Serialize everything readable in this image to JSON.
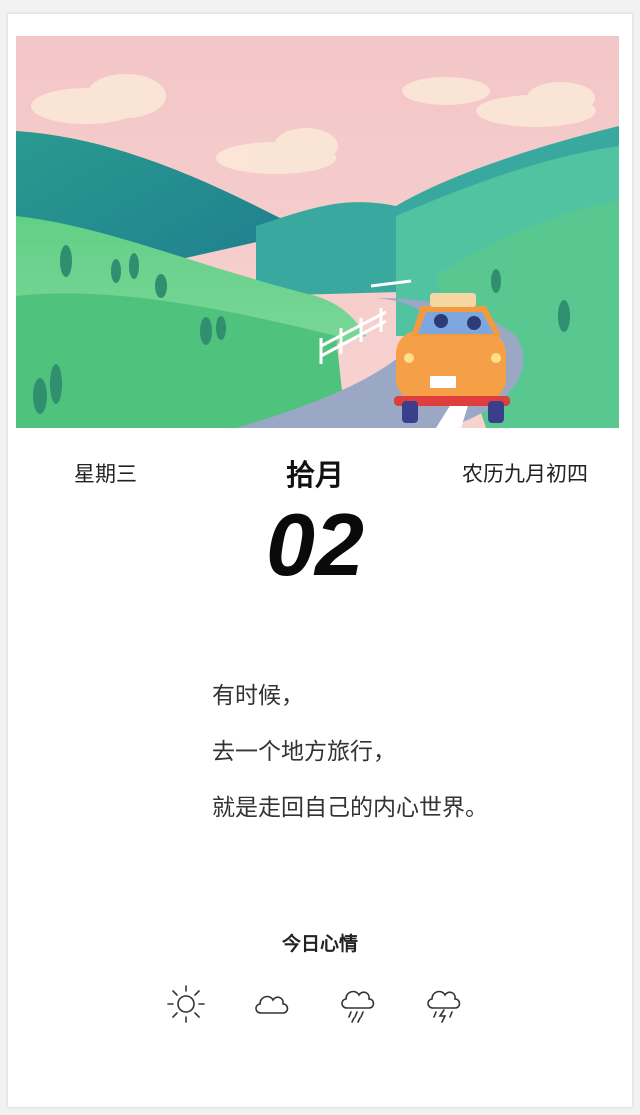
{
  "calendar": {
    "weekday": "星期三",
    "month": "拾月",
    "lunar_date": "农历九月初四",
    "day": "02"
  },
  "quote": {
    "lines": [
      "有时候，",
      "去一个地方旅行，",
      "就是走回自己的内心世界。"
    ]
  },
  "mood": {
    "title": "今日心情",
    "options": [
      "sun-icon",
      "cloud-icon",
      "rain-icon",
      "thunderstorm-icon"
    ]
  },
  "colors": {
    "sky": "#f2c7c9",
    "hill_green": "#3fbf8a",
    "hill_teal": "#2e9f9b",
    "road": "#9ba9c4",
    "car": "#f5a046"
  }
}
